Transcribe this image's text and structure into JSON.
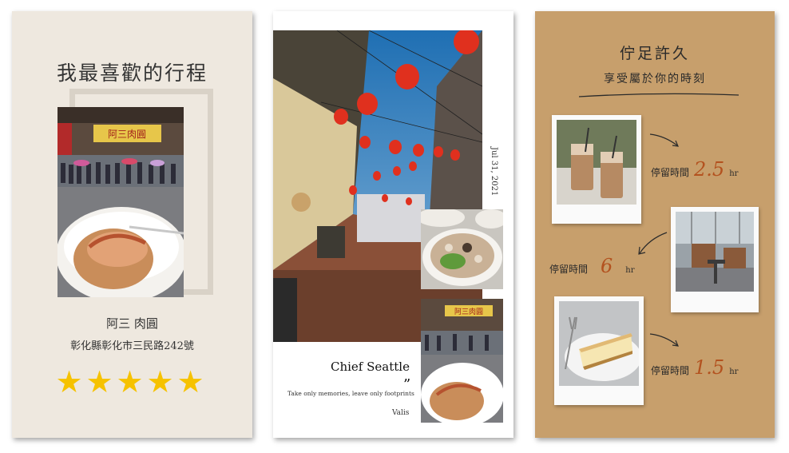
{
  "card1": {
    "title": "我最喜歡的行程",
    "name": "阿三 肉圓",
    "address": "彰化縣彰化市三民路242號",
    "rating": 5,
    "star_char": "★",
    "shop_sign": "阿三肉圓"
  },
  "card2": {
    "date": "Jul 31, 2021",
    "quote_title": "Chief Seattle",
    "quote_mark": "”",
    "quote_text": "Take only memories, leave only footprints",
    "quote_author": "Valis",
    "shop_sign": "阿三肉圓"
  },
  "card3": {
    "title": "佇足許久",
    "subtitle": "享受屬於你的時刻",
    "stays": [
      {
        "label": "停留時間",
        "value": "2.5",
        "unit": "hr"
      },
      {
        "label": "停留時間",
        "value": "6",
        "unit": "hr"
      },
      {
        "label": "停留時間",
        "value": "1.5",
        "unit": "hr"
      }
    ]
  },
  "colors": {
    "card1_bg": "#eee8df",
    "card3_bg": "#c79f6c",
    "star": "#f6c200",
    "accent_number": "#b3521f"
  }
}
